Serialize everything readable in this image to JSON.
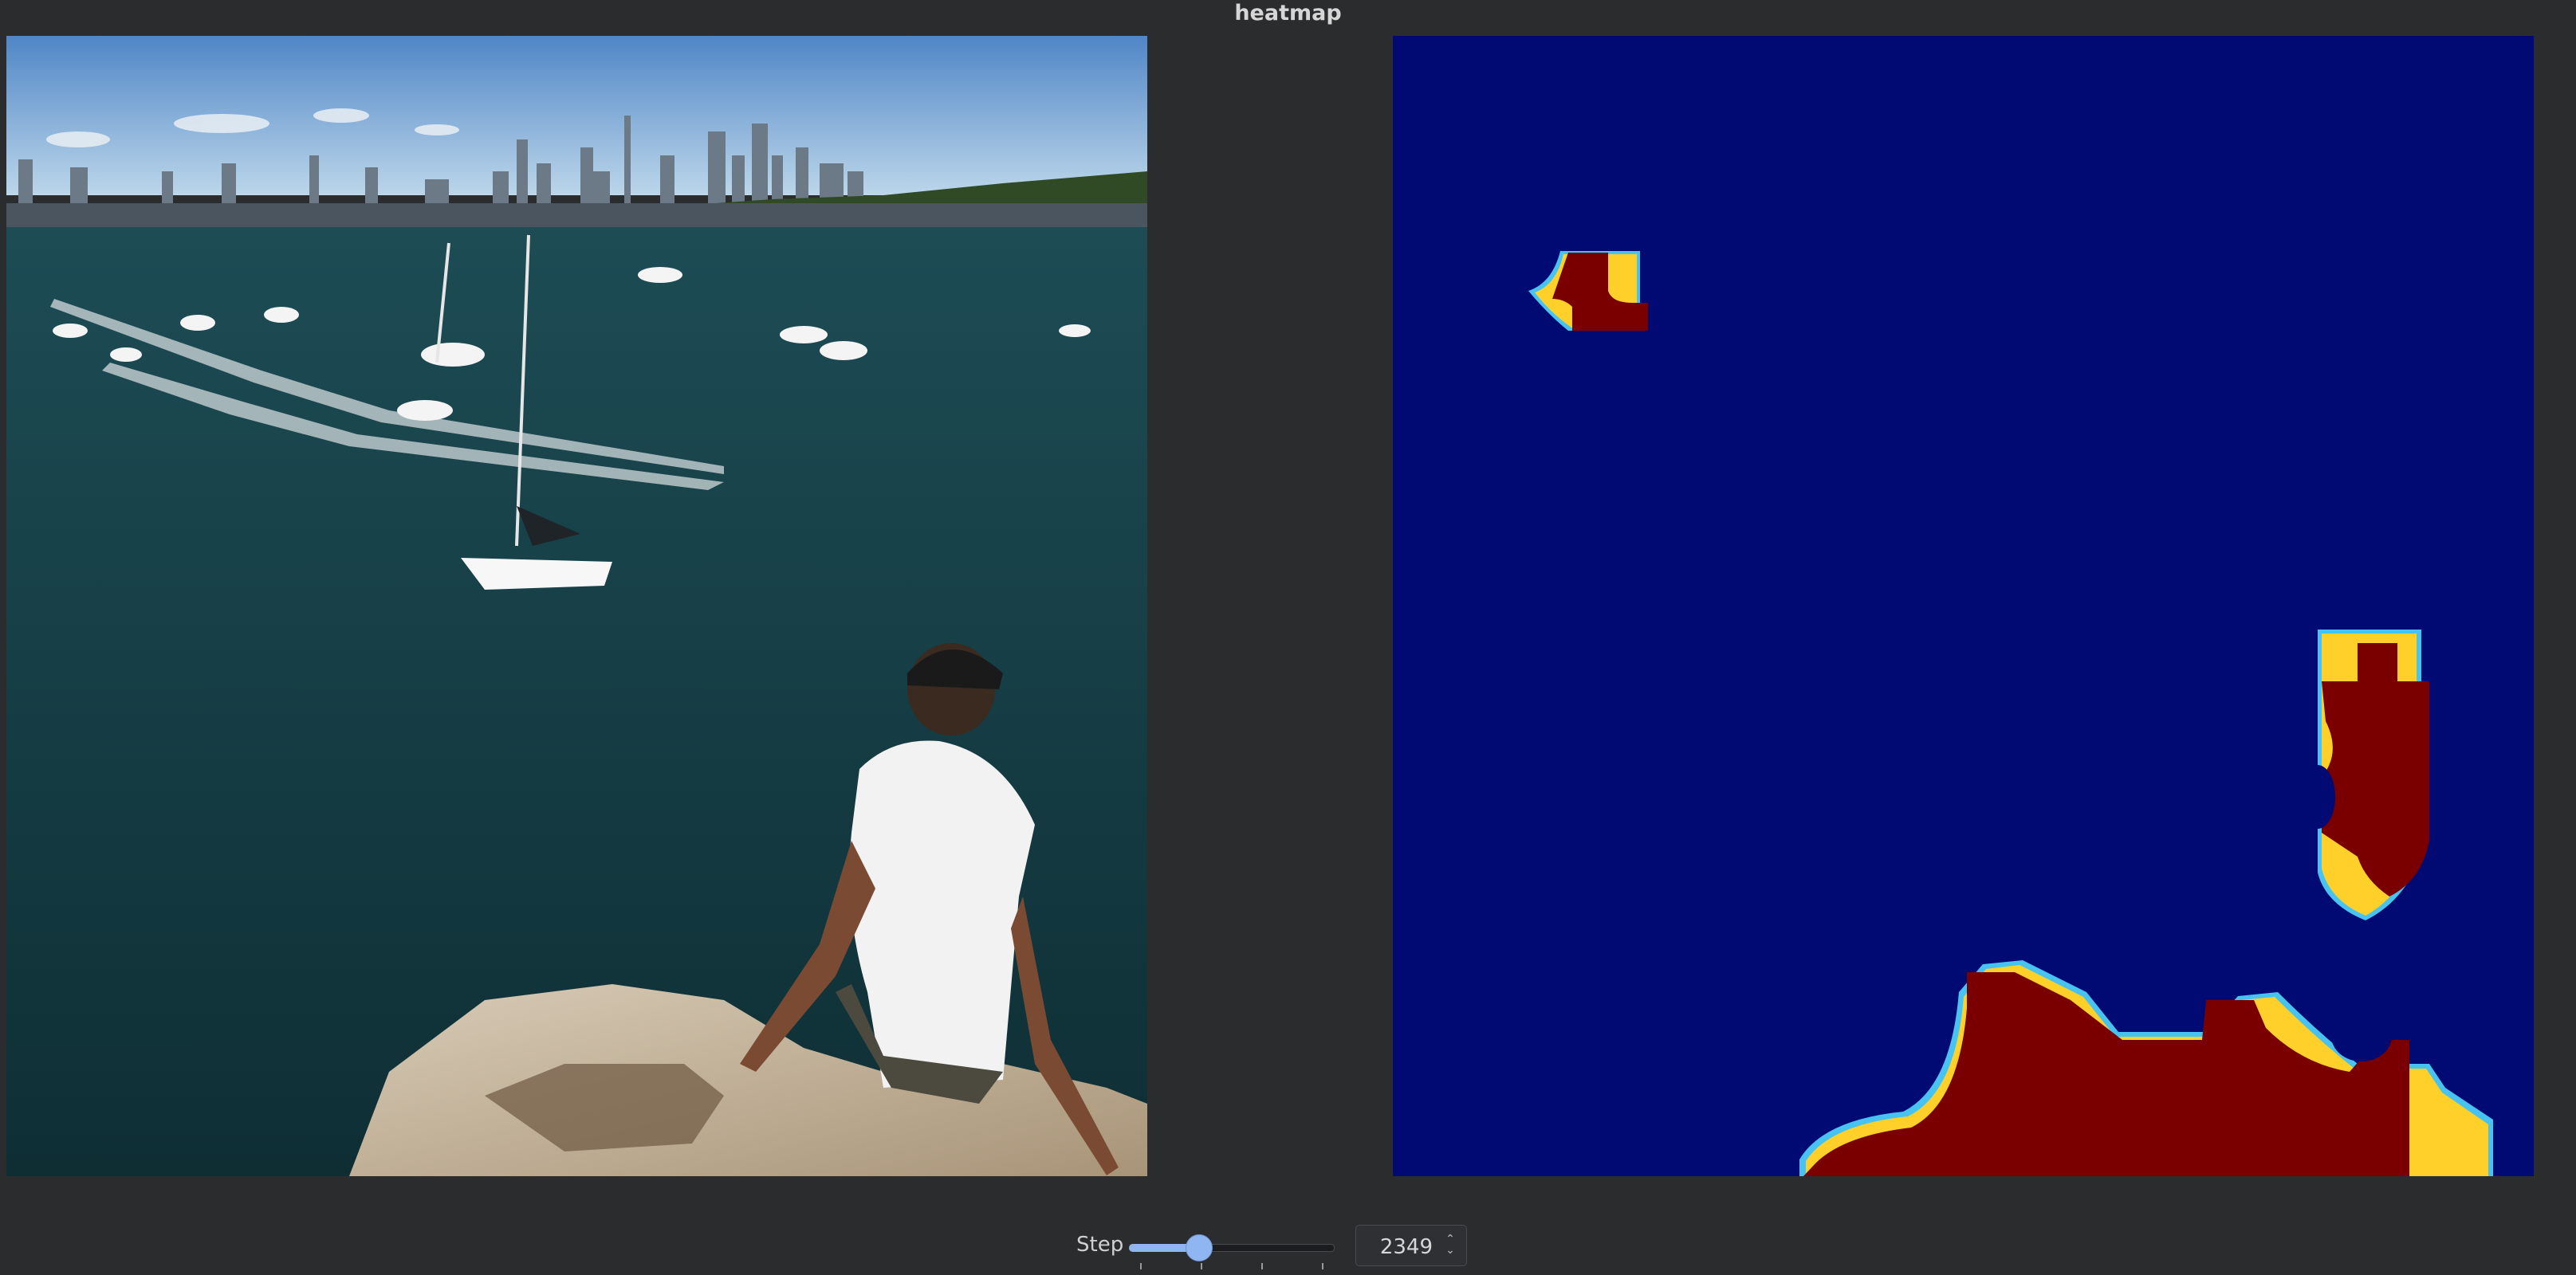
{
  "window": {
    "title": "heatmap"
  },
  "panels": {
    "left": {
      "content": "photo-man-sitting-on-rock-overlooking-harbor-with-boats-and-city-skyline"
    },
    "right": {
      "content": "jet-colormap-heatmap",
      "colors": {
        "background": "#000a72",
        "hot": "#7a0000"
      }
    }
  },
  "controls": {
    "step_label": "Step",
    "slider_value_fraction": 0.34,
    "spin_value": "2349"
  }
}
